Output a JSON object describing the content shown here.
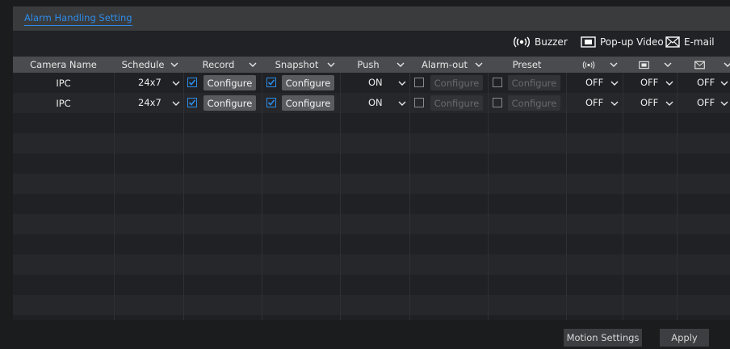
{
  "tabs": {
    "active": "Alarm Handling Setting"
  },
  "toolbar": {
    "buzzer": "Buzzer",
    "popup_video": "Pop-up Video",
    "email": "E-mail"
  },
  "columns": {
    "camera_name": "Camera Name",
    "schedule": "Schedule",
    "record": "Record",
    "snapshot": "Snapshot",
    "push": "Push",
    "alarm_out": "Alarm-out",
    "preset": "Preset",
    "buzzer_icon": "buzzer-icon",
    "popup_icon": "popup-video-icon",
    "email_icon": "email-icon"
  },
  "rows": [
    {
      "camera": "IPC",
      "schedule": "24x7",
      "record_checked": true,
      "record_btn": "Configure",
      "snapshot_checked": true,
      "snapshot_btn": "Configure",
      "push": "ON",
      "alarm_out_checked": false,
      "alarm_out_btn": "Configure",
      "preset_checked": false,
      "preset_btn": "Configure",
      "buzzer": "OFF",
      "popup": "OFF",
      "email": "OFF"
    },
    {
      "camera": "IPC",
      "schedule": "24x7",
      "record_checked": true,
      "record_btn": "Configure",
      "snapshot_checked": true,
      "snapshot_btn": "Configure",
      "push": "ON",
      "alarm_out_checked": false,
      "alarm_out_btn": "Configure",
      "preset_checked": false,
      "preset_btn": "Configure",
      "buzzer": "OFF",
      "popup": "OFF",
      "email": "OFF"
    }
  ],
  "footer": {
    "motion_settings": "Motion Settings",
    "apply": "Apply"
  },
  "colors": {
    "accent": "#2d8ce8",
    "header_bg": "#4a4b4e",
    "tabbar_bg": "#3a3b3d",
    "page_bg": "#1b1c1e"
  }
}
